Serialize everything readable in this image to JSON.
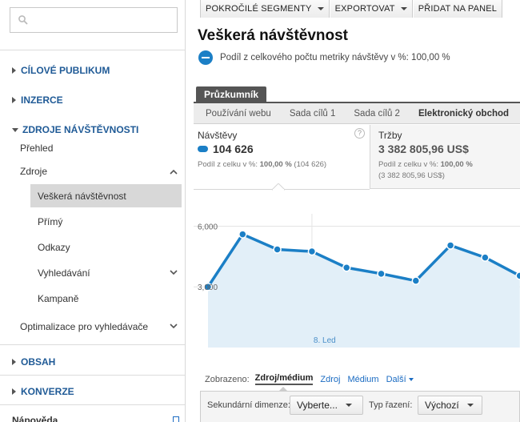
{
  "sidebar": {
    "search": {
      "placeholder": "",
      "value": ""
    },
    "sections": [
      {
        "label": "CÍLOVÉ PUBLIKUM"
      },
      {
        "label": "INZERCE"
      },
      {
        "label": "ZDROJE NÁVŠTĚVNOSTI"
      },
      {
        "label": "OBSAH"
      },
      {
        "label": "KONVERZE"
      },
      {
        "label": "Nápověda"
      }
    ],
    "traffic": {
      "overview": "Přehled",
      "sources": "Zdroje",
      "all_traffic": "Veškerá návštěvnost",
      "direct": "Přímý",
      "referrals": "Odkazy",
      "search": "Vyhledávání",
      "campaigns": "Kampaně",
      "seo": "Optimalizace pro vyhledávače"
    }
  },
  "toolbar": {
    "advanced_segments": "POKROČILÉ SEGMENTY",
    "export": "EXPORTOVAT",
    "add_to_dashboard": "PŘIDAT NA PANEL"
  },
  "page": {
    "title": "Veškerá návštěvnost",
    "segment_text": "Podíl z celkového počtu metriky návštěvy v %: 100,00 %"
  },
  "explorer": {
    "tab": "Průzkumník",
    "subtabs": [
      "Používání webu",
      "Sada cílů 1",
      "Sada cílů 2",
      "Elektronický obchod"
    ],
    "active_subtab": 3
  },
  "metrics": {
    "left": {
      "name": "Návštěvy",
      "value": "104 626",
      "sub_label": "Podíl z celku v %:",
      "sub_pct": "100,00 %",
      "sub_total": "(104 626)"
    },
    "right": {
      "name": "Tržby",
      "value": "3 382 805,96 US$",
      "sub_label": "Podíl z celku v %:",
      "sub_pct": "100,00 %",
      "sub_total": "(3 382 805,96 US$)"
    },
    "help": "?"
  },
  "chart_data": {
    "type": "area",
    "series": [
      {
        "name": "Návštěvy",
        "values": [
          3000,
          5600,
          4850,
          4750,
          3950,
          3650,
          3300,
          5050,
          4450,
          3550
        ]
      }
    ],
    "y_ticks": [
      "6,000",
      "3,000"
    ],
    "ylim": [
      0,
      7800
    ],
    "annotation": "8. Led",
    "color": "#1b7fc6",
    "fill": "#e2eff8",
    "grid": true
  },
  "view": {
    "label": "Zobrazeno:",
    "current": "Zdroj/médium",
    "options": [
      "Zdroj",
      "Médium"
    ],
    "more": "Další"
  },
  "dimension": {
    "secondary_label": "Sekundární dimenze:",
    "secondary_value": "Vyberte...",
    "sort_label": "Typ řazení:",
    "sort_value": "Výchozí"
  }
}
